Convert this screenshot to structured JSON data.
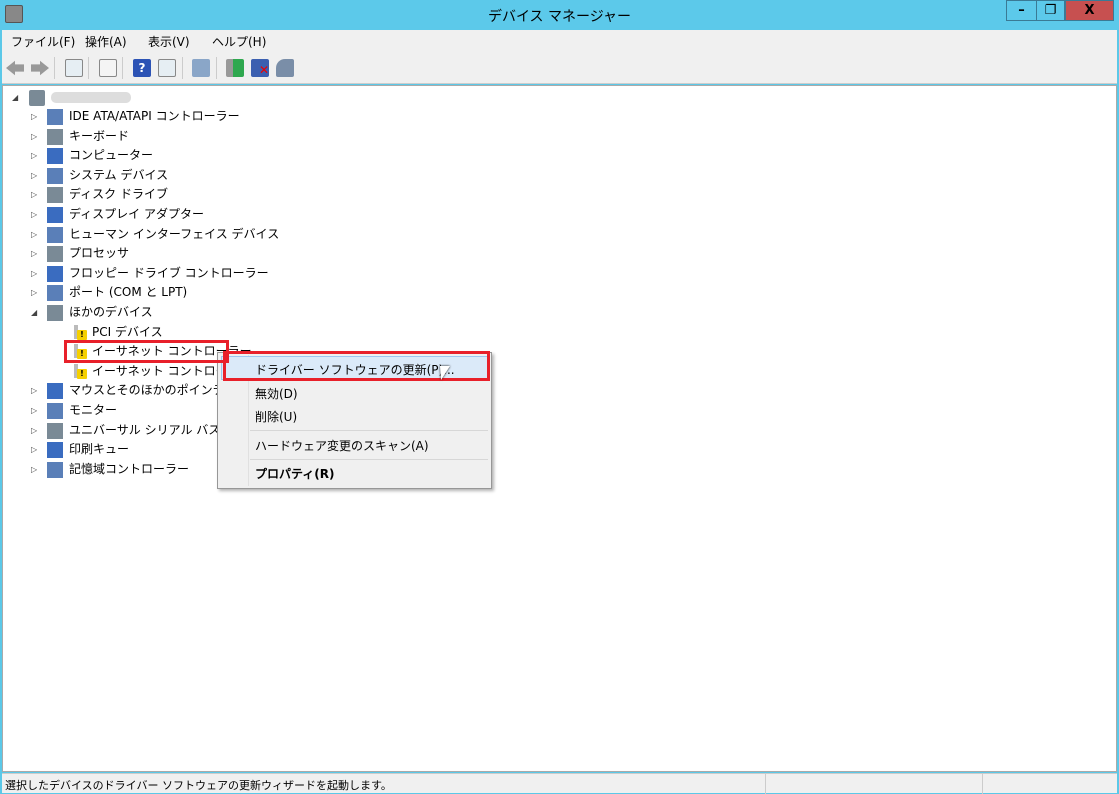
{
  "window": {
    "title": "デバイス マネージャー",
    "minimize": "–",
    "restore": "❐",
    "close": "X"
  },
  "menu": [
    "ファイル(F)",
    "操作(A)",
    "表示(V)",
    "ヘルプ(H)"
  ],
  "toolbar": [
    "back-icon",
    "forward-icon",
    "show-hide-console-tree-icon",
    "properties-icon",
    "help-icon",
    "action-pane-icon",
    "scan-hardware-icon",
    "update-driver-icon",
    "uninstall-icon",
    "disable-icon"
  ],
  "tree": {
    "root": "",
    "items": [
      {
        "label": "IDE ATA/ATAPI コントローラー",
        "icon": "ide-controller-icon"
      },
      {
        "label": "キーボード",
        "icon": "keyboard-icon"
      },
      {
        "label": "コンピューター",
        "icon": "computer-icon"
      },
      {
        "label": "システム デバイス",
        "icon": "system-device-icon"
      },
      {
        "label": "ディスク ドライブ",
        "icon": "disk-drive-icon"
      },
      {
        "label": "ディスプレイ アダプター",
        "icon": "display-adapter-icon"
      },
      {
        "label": "ヒューマン インターフェイス デバイス",
        "icon": "hid-icon"
      },
      {
        "label": "プロセッサ",
        "icon": "processor-icon"
      },
      {
        "label": "フロッピー ドライブ コントローラー",
        "icon": "floppy-controller-icon"
      },
      {
        "label": "ポート (COM と LPT)",
        "icon": "port-icon"
      },
      {
        "label": "ほかのデバイス",
        "icon": "other-devices-icon",
        "expanded": true
      },
      {
        "label": "PCI デバイス",
        "icon": "warning-device-icon",
        "child": true
      },
      {
        "label": "イーサネット コントローラー",
        "icon": "warning-device-icon",
        "child": true,
        "selected": true
      },
      {
        "label": "イーサネット コントローラー",
        "icon": "warning-device-icon",
        "child": true
      },
      {
        "label": "マウスとそのほかのポインティング デバイス",
        "icon": "mouse-icon"
      },
      {
        "label": "モニター",
        "icon": "monitor-icon"
      },
      {
        "label": "ユニバーサル シリアル バス コントローラー",
        "icon": "usb-icon"
      },
      {
        "label": "印刷キュー",
        "icon": "printer-icon"
      },
      {
        "label": "記憶域コントローラー",
        "icon": "storage-controller-icon"
      }
    ]
  },
  "context_menu": {
    "update_driver": "ドライバー ソフトウェアの更新(P)...",
    "disable": "無効(D)",
    "uninstall": "削除(U)",
    "scan": "ハードウェア変更のスキャン(A)",
    "properties": "プロパティ(R)"
  },
  "status": "選択したデバイスのドライバー ソフトウェアの更新ウィザードを起動します。",
  "colors": {
    "titlebar": "#5cc9ea",
    "close": "#c75050",
    "highlight": "#e8202a"
  }
}
